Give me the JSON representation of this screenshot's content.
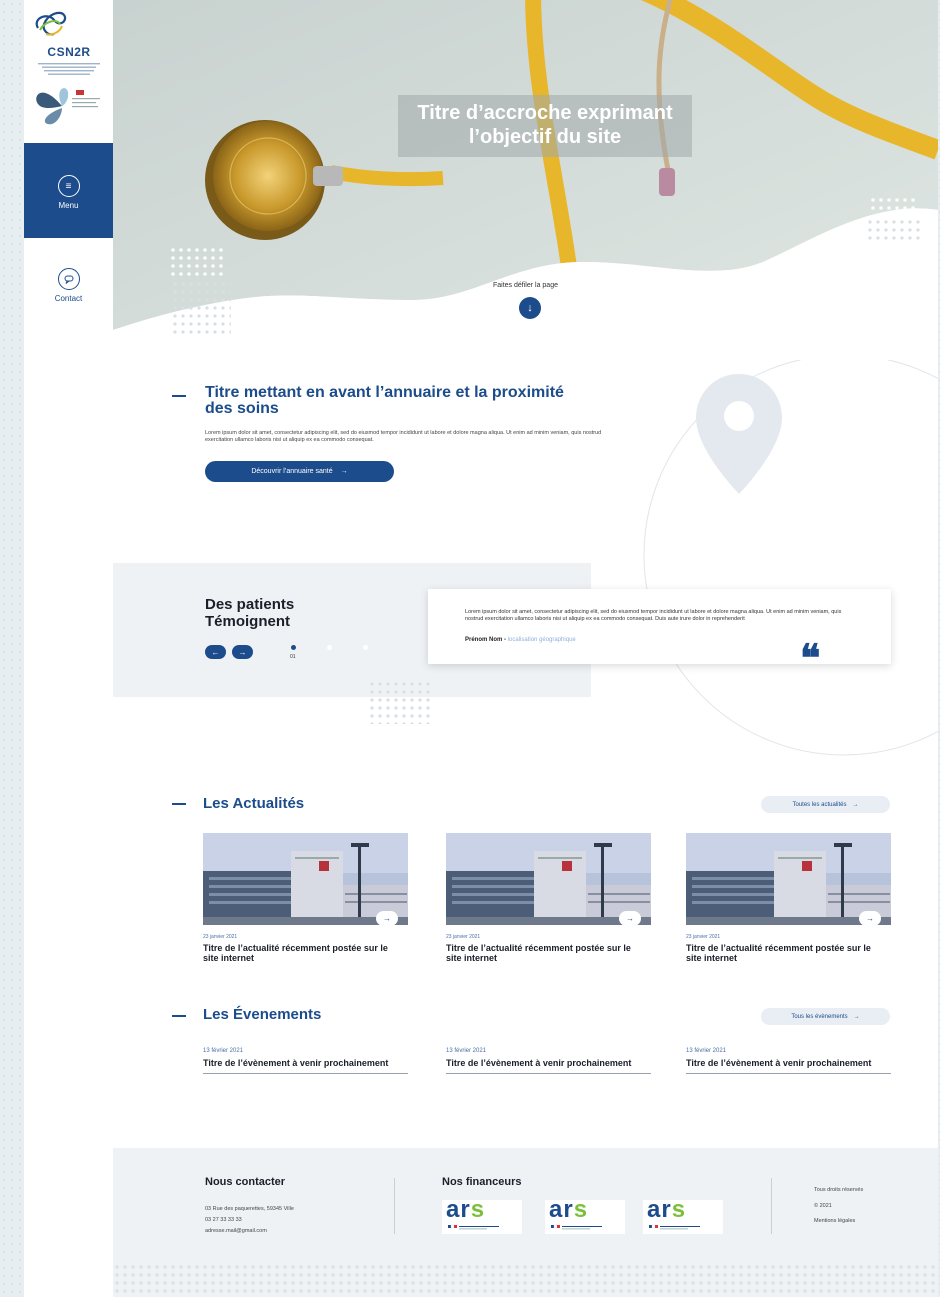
{
  "brand": {
    "name": "CSN2R",
    "primary_color": "#1c4c8b",
    "accent_yellow": "#e8b62a"
  },
  "sidebar": {
    "menu_label": "Menu",
    "contact_label": "Contact",
    "menu_icon": "menu-lines-icon",
    "contact_icon": "chat-bubble-icon"
  },
  "hero": {
    "title": "Titre d’accroche exprimant l’objectif du site",
    "scroll_text": "Faites défiler la page"
  },
  "annuaire": {
    "title": "Titre mettant en avant l’annuaire et la proximité des soins",
    "text": "Lorem ipsum dolor sit amet, consectetur adipiscing elit, sed do eiusmod tempor incididunt ut labore et dolore magna aliqua. Ut enim ad minim veniam, quis nostrud exercitation ullamco laboris nisi ut aliquip ex ea commodo consequat.",
    "button": "Découvrir l’annuaire santé",
    "icon": "map-pin-icon"
  },
  "testimonials": {
    "title_line1": "Des patients",
    "title_line2": "Témoignent",
    "page_number": "01",
    "text": "Lorem ipsum dolor sit amet, consectetur adipiscing elit, sed do eiusmod tempor incididunt ut labore et dolore magna aliqua. Ut enim ad minim veniam, quis nostrud exercitation ullamco laboris nisi ut aliquip ex ea commodo consequat. Duis aute irure dolor in reprehenderit",
    "author": "Prénom Nom",
    "location": "localisation géographique",
    "quote_mark": "❝"
  },
  "news": {
    "title": "Les Actualités",
    "all_link": "Toutes les actualités",
    "items": [
      {
        "date": "23 janvier 2021",
        "title": "Titre de l’actualité récemment postée sur le site internet"
      },
      {
        "date": "23 janvier 2021",
        "title": "Titre de l’actualité récemment postée sur le site internet"
      },
      {
        "date": "23 janvier 2021",
        "title": "Titre de l’actualité récemment postée sur le site internet"
      }
    ]
  },
  "events": {
    "title": "Les Évenements",
    "all_link": "Tous les évènements",
    "items": [
      {
        "date": "13 février 2021",
        "title": "Titre de l’évènement à venir prochainement"
      },
      {
        "date": "13 février 2021",
        "title": "Titre de l’évènement à venir prochainement"
      },
      {
        "date": "13 février 2021",
        "title": "Titre de l’évènement à venir prochainement"
      }
    ]
  },
  "footer": {
    "contact_title": "Nous contacter",
    "address": "03 Rue des paquerettes, 59345 Ville",
    "phone": "03 27 33 33 33",
    "email": "adresse.mail@gmail.com",
    "funders_title": "Nos financeurs",
    "funder_word": "ars",
    "rights": "Tous droits réservés",
    "year": "© 2021",
    "legal": "Mentions légales"
  },
  "arrow_glyph": "→"
}
